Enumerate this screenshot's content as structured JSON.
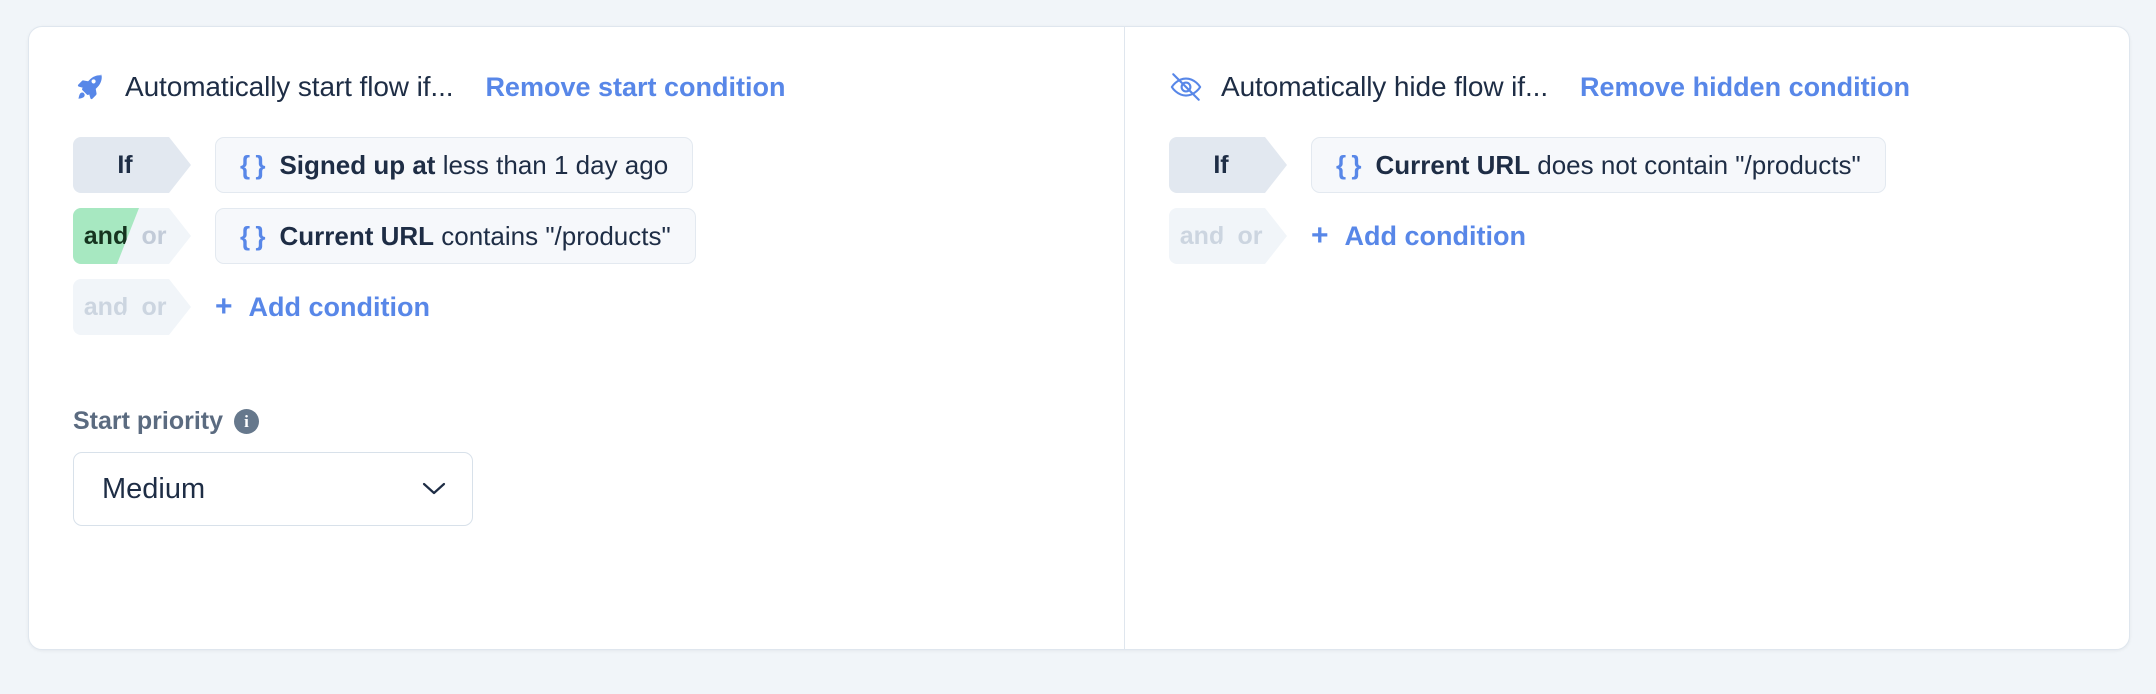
{
  "panels": [
    {
      "id": "start",
      "icon": "rocket-icon",
      "title": "Automatically start flow if...",
      "remove_link": "Remove start condition",
      "rows": [
        {
          "connector_type": "if",
          "connector_label": "If",
          "braces": "{ }",
          "bold_text": "Signed up at",
          "rest_text": " less than 1 day ago"
        },
        {
          "connector_type": "and-or",
          "connector_and": "and",
          "connector_or": "or",
          "connector_active": "and",
          "braces": "{ }",
          "bold_text": "Current URL",
          "rest_text": " contains \"/products\""
        }
      ],
      "add_row": {
        "connector_and": "and",
        "connector_or": "or",
        "plus": "+",
        "label": "Add condition"
      },
      "priority": {
        "label": "Start priority",
        "info_icon": "info-icon",
        "info_glyph": "i",
        "selected": "Medium"
      }
    },
    {
      "id": "hide",
      "icon": "eye-off-icon",
      "title": "Automatically hide flow if...",
      "remove_link": "Remove hidden condition",
      "rows": [
        {
          "connector_type": "if",
          "connector_label": "If",
          "braces": "{ }",
          "bold_text": "Current URL",
          "rest_text": " does not contain \"/products\""
        }
      ],
      "add_row": {
        "connector_and": "and",
        "connector_or": "or",
        "plus": "+",
        "label": "Add condition"
      }
    }
  ],
  "colors": {
    "accent_blue": "#5887e8",
    "text_dark": "#1e2d45",
    "active_green": "#a7e8c1",
    "badge_gray": "#e2e8f0",
    "page_bg": "#f1f5f9"
  }
}
